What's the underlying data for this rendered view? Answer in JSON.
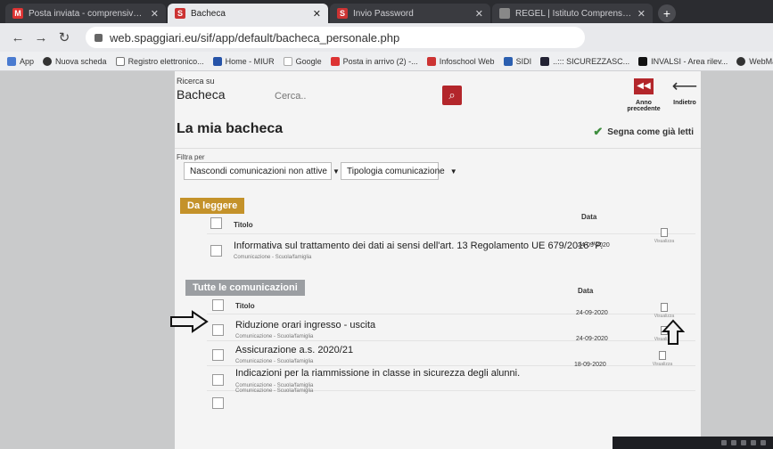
{
  "browser": {
    "tabs": [
      {
        "icon": "gmail-icon",
        "title": "Posta inviata - comprensivo.cana",
        "active": false
      },
      {
        "icon": "spaggiari-icon",
        "title": "Bacheca",
        "active": true
      },
      {
        "icon": "spaggiari-icon",
        "title": "Invio Password",
        "active": false
      },
      {
        "icon": "page-icon",
        "title": "REGEL | Istituto Comprensivo Ca",
        "active": false
      }
    ],
    "new_tab": "+",
    "url": "web.spaggiari.eu/sif/app/default/bacheca_personale.php",
    "bookmarks": [
      "App",
      "Nuova scheda",
      "Registro elettronico...",
      "Home - MIUR",
      "Google",
      "Posta in arrivo (2) -...",
      "Infoschool Web",
      "SIDI",
      "..::: SICUREZZASC...",
      "INVALSI - Area rilev...",
      "WebMail - Desktop"
    ]
  },
  "search": {
    "label_small": "Ricerca su",
    "label_big": "Bacheca",
    "placeholder": "Cerca..",
    "prev_year_label": "Anno precedente",
    "back_label": "Indietro"
  },
  "page_title": "La mia bacheca",
  "mark_all_read": "Segna come già letti",
  "filters": {
    "label": "Filtra per",
    "status_select": "Nascondi comunicazioni non attive",
    "type_select": "Tipologia comunicazione"
  },
  "to_read": {
    "section_label": "Da leggere",
    "col_title": "Titolo",
    "col_date": "Data",
    "rows": [
      {
        "title": "Informativa sul trattamento dei dati ai sensi dell'art. 13 Regolamento UE 679/2016 \"P.",
        "subtitle": "Comunicazione - Scuola/famiglia",
        "date": "24-09-2020",
        "action": "Visualizza"
      }
    ]
  },
  "all_comms": {
    "section_label": "Tutte le comunicazioni",
    "col_title": "Titolo",
    "col_date": "Data",
    "rows": [
      {
        "title": "Riduzione orari ingresso - uscita",
        "subtitle": "Comunicazione - Scuola/famiglia",
        "date": "24-09-2020",
        "action": "Visualizza"
      },
      {
        "title": "Assicurazione a.s. 2020/21",
        "subtitle": "Comunicazione - Scuola/famiglia",
        "date": "24-09-2020",
        "action": "Visualizza"
      },
      {
        "title": "Indicazioni per la riammissione in classe in sicurezza degli alunni.",
        "subtitle": "Comunicazione - Scuola/famiglia",
        "date": "18-09-2020",
        "action": "Visualizza"
      },
      {
        "title": "",
        "subtitle": "Comunicazione - Scuola/famiglia",
        "date": "",
        "action": ""
      }
    ]
  },
  "colors": {
    "brand_red": "#b3262b",
    "to_read_header": "#c4922a",
    "all_comms_header": "#9b9ea2"
  }
}
